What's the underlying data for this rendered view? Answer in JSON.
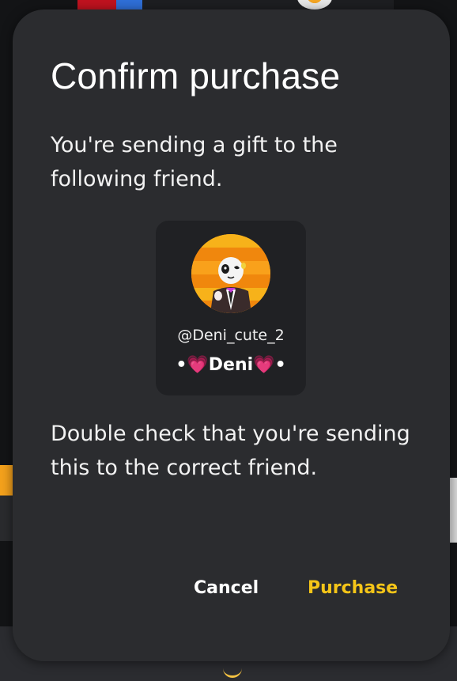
{
  "dialog": {
    "title": "Confirm purchase",
    "intro_text": "You're sending a gift to the following friend.",
    "warning_text": "Double check that you're sending this to the correct friend.",
    "cancel_label": "Cancel",
    "purchase_label": "Purchase"
  },
  "friend": {
    "handle": "@Deni_cute_2",
    "display_name": "•💗Deni💗•"
  },
  "colors": {
    "dialog_background": "#2b2c2f",
    "card_background": "#202124",
    "accent": "#f5c518",
    "text": "#ffffff"
  },
  "icons": {
    "avatar": "friend-avatar-image",
    "spinner": "loading-spinner-icon"
  }
}
